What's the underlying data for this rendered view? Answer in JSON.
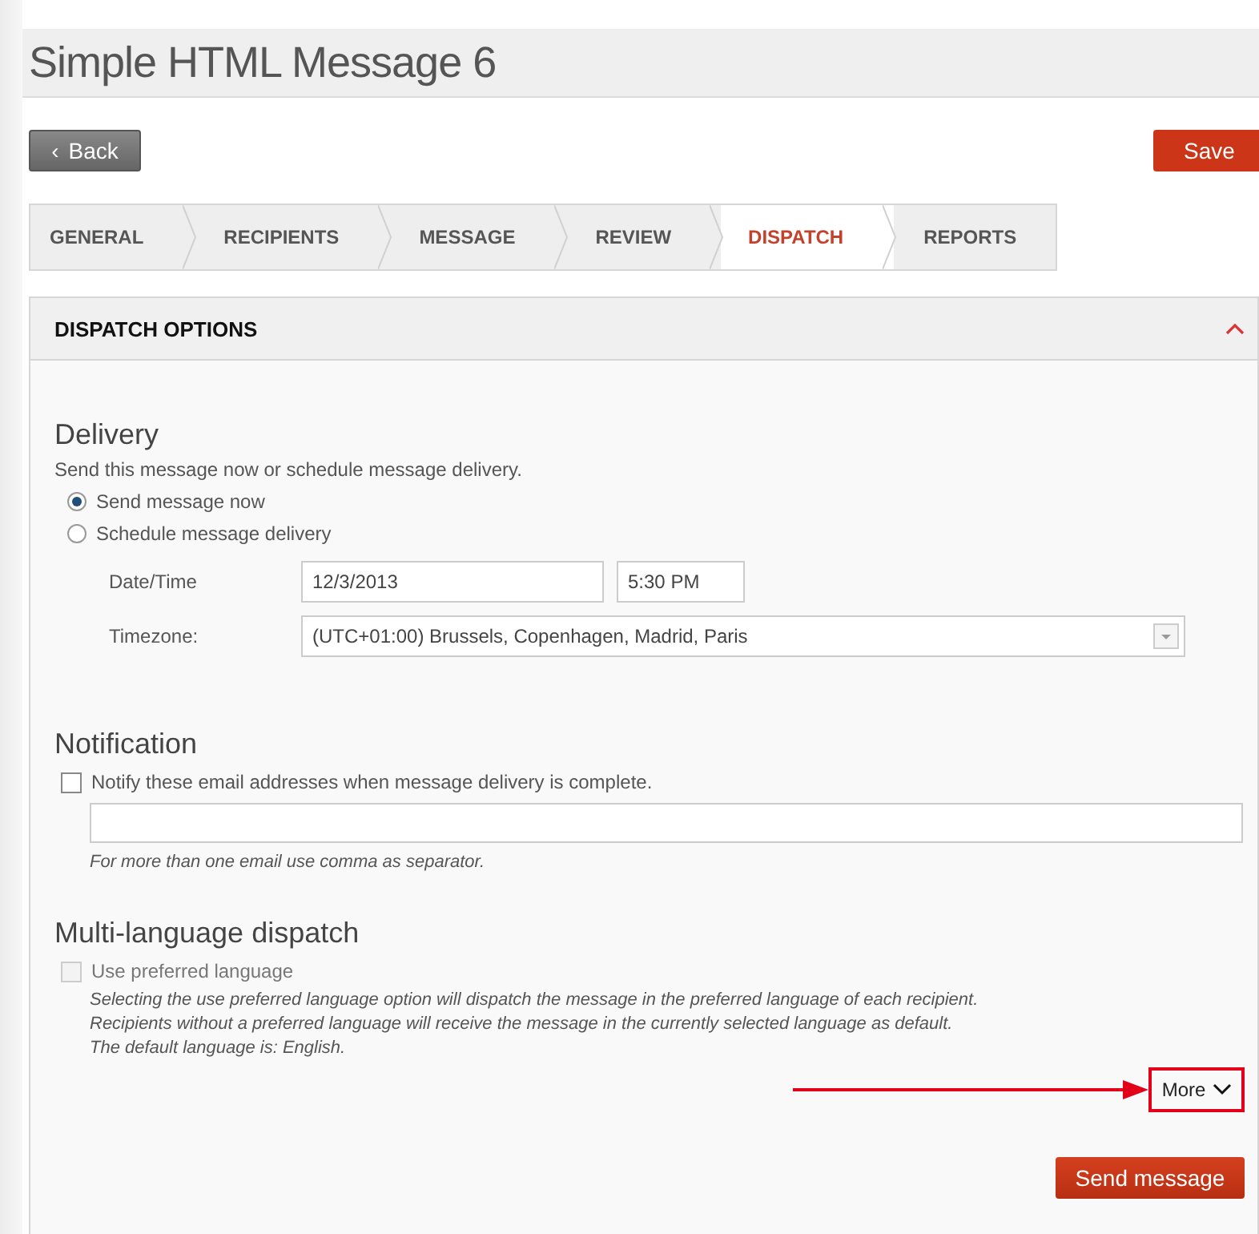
{
  "title": "Simple HTML Message 6",
  "toolbar": {
    "back": {
      "icon": "‹",
      "label": "Back"
    },
    "save": "Save"
  },
  "tabs": [
    {
      "label": "GENERAL",
      "selected": false
    },
    {
      "label": "RECIPIENTS",
      "selected": false
    },
    {
      "label": "MESSAGE",
      "selected": false
    },
    {
      "label": "REVIEW",
      "selected": false
    },
    {
      "label": "DISPATCH",
      "selected": true
    },
    {
      "label": "REPORTS",
      "selected": false
    }
  ],
  "panel": {
    "title": "DISPATCH OPTIONS",
    "expanded": true,
    "delivery": {
      "heading": "Delivery",
      "description": "Send this message now or schedule message delivery.",
      "options": [
        {
          "label": "Send message now",
          "selected": true
        },
        {
          "label": "Schedule message delivery",
          "selected": false
        }
      ],
      "date_label": "Date/Time",
      "date": "12/3/2013",
      "time": "5:30 PM",
      "timezone_label": "Timezone:",
      "timezone": "(UTC+01:00) Brussels, Copenhagen, Madrid, Paris"
    },
    "notification": {
      "heading": "Notification",
      "checkbox": {
        "label": "Notify these email addresses when message delivery is complete.",
        "checked": false,
        "disabled": false
      },
      "hint": "For more than one email use comma as separator."
    },
    "multilanguage": {
      "heading": "Multi-language dispatch",
      "checkbox": {
        "label": "Use preferred language",
        "checked": false,
        "disabled": true
      },
      "notes": [
        "Selecting the use preferred language option will dispatch the message in the preferred language of each recipient.",
        "Recipients without a preferred language will receive the message in the currently selected language as default.",
        "The default language is: English."
      ]
    },
    "more": {
      "label": "More",
      "highlighted": true
    },
    "send": "Send message"
  }
}
